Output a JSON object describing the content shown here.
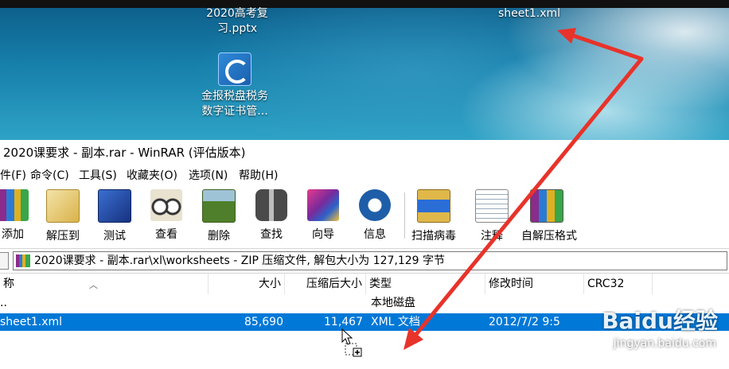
{
  "desktop": {
    "icons": [
      {
        "name": "pptx-file",
        "label_line1": "2020高考复",
        "label_line2": "习.pptx"
      },
      {
        "name": "cert-app",
        "label_line1": "金报税盘税务",
        "label_line2": "数字证书管..."
      },
      {
        "name": "xml-file",
        "label_line1": "sheet1.xml",
        "label_line2": ""
      }
    ]
  },
  "window": {
    "title": "2020课要求 - 副本.rar - WinRAR (评估版本)",
    "menu": [
      "件(F)",
      "命令(C)",
      "工具(S)",
      "收藏夹(O)",
      "选项(N)",
      "帮助(H)"
    ],
    "toolbar": [
      {
        "label": "添加",
        "icon": "add-icon"
      },
      {
        "label": "解压到",
        "icon": "extract-to-icon"
      },
      {
        "label": "测试",
        "icon": "test-icon"
      },
      {
        "label": "查看",
        "icon": "view-icon"
      },
      {
        "label": "删除",
        "icon": "delete-icon"
      },
      {
        "label": "查找",
        "icon": "find-icon"
      },
      {
        "label": "向导",
        "icon": "wizard-icon"
      },
      {
        "label": "信息",
        "icon": "info-icon"
      },
      {
        "label": "扫描病毒",
        "icon": "virus-scan-icon"
      },
      {
        "label": "注释",
        "icon": "comment-icon"
      },
      {
        "label": "自解压格式",
        "icon": "sfx-icon"
      }
    ],
    "path": "2020课要求 - 副本.rar\\xl\\worksheets - ZIP 压缩文件, 解包大小为 127,129 字节",
    "columns": [
      "称",
      "大小",
      "压缩后大小",
      "类型",
      "修改时间",
      "CRC32"
    ],
    "rows": [
      {
        "name": "..",
        "size": "",
        "packed": "",
        "type": "本地磁盘",
        "modified": "",
        "crc": ""
      },
      {
        "name": "sheet1.xml",
        "size": "85,690",
        "packed": "11,467",
        "type": "XML 文档",
        "modified": "2012/7/2 9:5",
        "crc": ""
      }
    ]
  },
  "watermark": {
    "brand": "Baidu经验",
    "url": "jingyan.baidu.com"
  },
  "colors": {
    "selection": "#0078d7",
    "arrow": "#e8332a"
  }
}
